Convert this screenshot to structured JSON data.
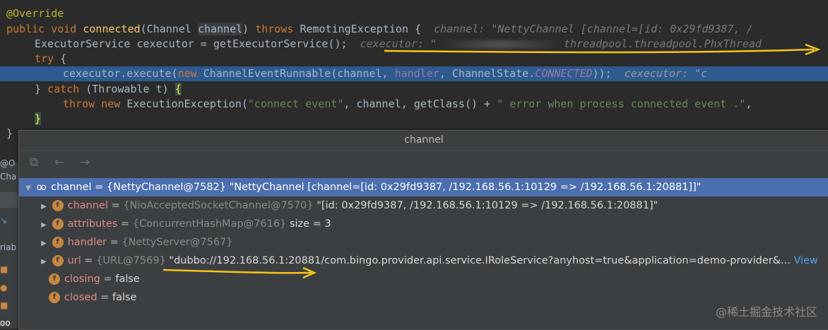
{
  "editor": {
    "lines": {
      "l1": "@Override",
      "l2": {
        "kw1": "public void ",
        "fn": "connected",
        "p1": "(Channel ",
        "param": "channel",
        "p2": ") ",
        "kw2": "throws ",
        "p3": "RemotingException {",
        "hint": "  channel: \"NettyChannel [channel=[id: 0x29fd9387, /"
      },
      "l3": {
        "code": "ExecutorService cexecutor = getExecutorService();",
        "hint_a": "  cexecutor: \"",
        "hint_b": "threadpool.threadpool.PhxThread"
      },
      "l4": {
        "kw": "try",
        "rest": " {"
      },
      "l5": {
        "a": "cexecutor.execute(",
        "kw": "new ",
        "b": "ChannelEventRunnable(channel, ",
        "handler": "handler",
        "c": ", ChannelState.",
        "const": "CONNECTED",
        "d": "));",
        "hint": "  cexecutor: \"c"
      },
      "l6": {
        "a": "} ",
        "kw": "catch ",
        "b": "(Throwable t) ",
        "bracket": "{"
      },
      "l7": {
        "kw": "throw new ",
        "a": "ExecutionException(",
        "str1": "\"connect event\"",
        "b": ", channel, getClass() + ",
        "str2": "\" error when process connected event .\"",
        "c": ","
      },
      "l8": "}",
      "l9": "}"
    }
  },
  "gutter": {
    "frag1": "@O",
    "frag2": "Cha",
    "frag3": "riab"
  },
  "popup": {
    "title": "channel",
    "toolbar": {
      "icon1": "restore-icon",
      "icon2": "back-icon",
      "icon3": "forward-icon"
    },
    "rows": [
      {
        "name": "channel",
        "type": "{NettyChannel@7582}",
        "value": "\"NettyChannel [channel=[id: 0x29fd9387, /192.168.56.1:10129 => /192.168.56.1:20881]]\""
      },
      {
        "name": "channel",
        "type": "{NioAcceptedSocketChannel@7570}",
        "value": "\"[id: 0x29fd9387, /192.168.56.1:10129 => /192.168.56.1:20881]\""
      },
      {
        "name": "attributes",
        "type": "{ConcurrentHashMap@7616}",
        "value": " size = 3"
      },
      {
        "name": "handler",
        "type": "{NettyServer@7567}",
        "value": ""
      },
      {
        "name": "url",
        "type": "{URL@7569}",
        "value": "\"dubbo://192.168.56.1:20881/com.bingo.provider.api.service.IRoleService?anyhost=true&application=demo-provider&...",
        "link": "View"
      },
      {
        "name": "closing",
        "type": "",
        "value": "false"
      },
      {
        "name": "closed",
        "type": "",
        "value": "false"
      }
    ],
    "eq": " = "
  },
  "watermark": "@稀土掘金技术社区",
  "colors": {
    "accent_arrow": "#f5c518",
    "selection": "#4b6eaf",
    "line_highlight": "#2d5a8f"
  }
}
